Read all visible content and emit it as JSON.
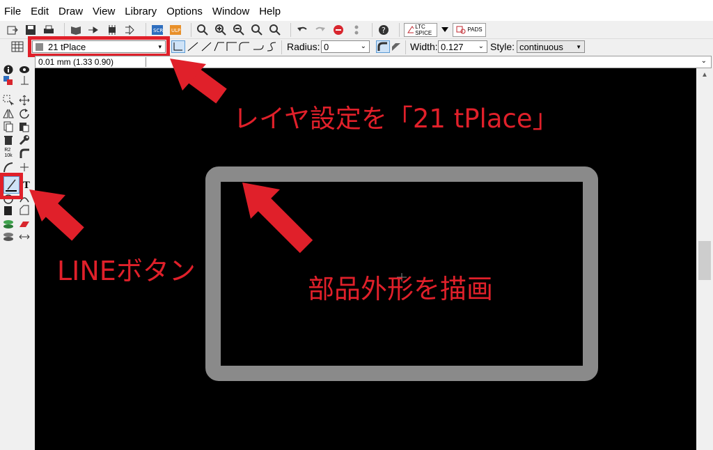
{
  "menu": [
    "File",
    "Edit",
    "Draw",
    "View",
    "Library",
    "Options",
    "Window",
    "Help"
  ],
  "toolbar": {
    "spice_label": "LTC SPICE",
    "pads_label": "PADS"
  },
  "properties": {
    "layer_value": "21 tPlace",
    "radius_label": "Radius:",
    "radius_value": "0",
    "width_label": "Width:",
    "width_value": "0.127",
    "style_label": "Style:",
    "style_value": "continuous"
  },
  "command_line": {
    "coordinate_readout": "0.01 mm (1.33 0.90)"
  },
  "annotations": {
    "layer_note": "レイヤ設定を「21 tPlace」",
    "line_button_note": "LINEボタン",
    "draw_note": "部品外形を描画"
  },
  "colors": {
    "annotation_red": "#e0202a",
    "canvas_background": "#000000",
    "outline_gray": "#8a8a8a"
  }
}
